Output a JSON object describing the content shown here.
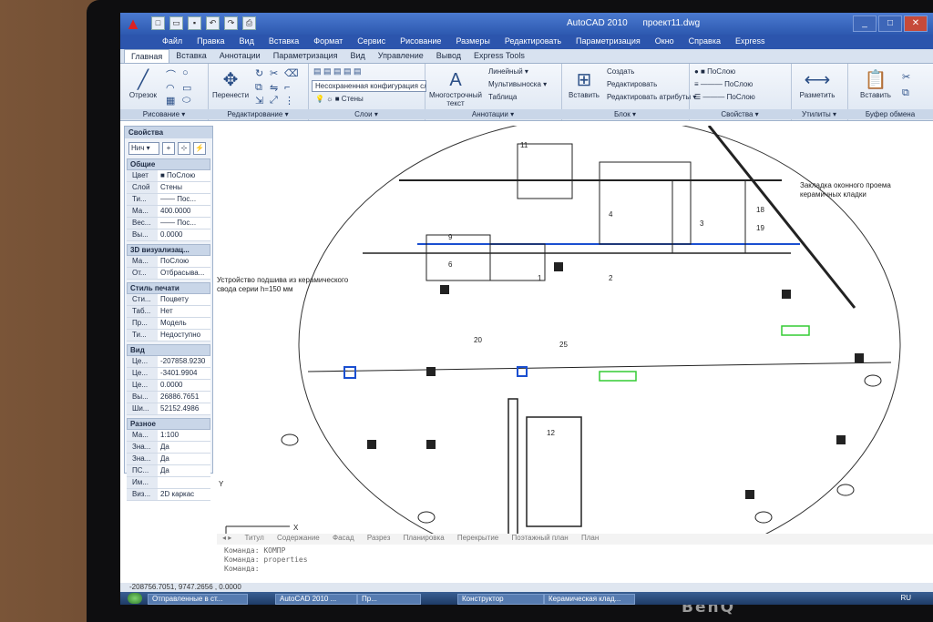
{
  "window": {
    "app_title": "AutoCAD 2010",
    "file_title": "проект11.dwg"
  },
  "menu": [
    "Файл",
    "Правка",
    "Вид",
    "Вставка",
    "Формат",
    "Сервис",
    "Рисование",
    "Размеры",
    "Редактировать",
    "Параметризация",
    "Окно",
    "Справка",
    "Express"
  ],
  "tabs": [
    "Главная",
    "Вставка",
    "Аннотации",
    "Параметризация",
    "Вид",
    "Управление",
    "Вывод",
    "Express Tools"
  ],
  "ribbon": {
    "draw": {
      "line_label": "Отрезок",
      "panel": "Рисование ▾"
    },
    "modify": {
      "move_label": "Перенести",
      "panel": "Редактирование ▾"
    },
    "layers": {
      "layer_state": "Несохраненная конфигурация сл ▾",
      "current_layer": "Стены",
      "panel": "Слои ▾"
    },
    "annotation": {
      "mtext_label": "Многострочный текст",
      "linear": "Линейный ▾",
      "mleader": "Мультивыноска ▾",
      "table": "Таблица",
      "panel": "Аннотации ▾"
    },
    "block": {
      "insert_label": "Вставить",
      "create": "Создать",
      "edit": "Редактировать",
      "edit_attr": "Редактировать атрибуты ▾",
      "panel": "Блок ▾"
    },
    "properties": {
      "color": "ПоСлою",
      "linetype": "ПоСлою",
      "lineweight": "ПоСлою",
      "panel": "Свойства ▾"
    },
    "utilities": {
      "measure_label": "Разметить",
      "panel": "Утилиты ▾"
    },
    "clipboard": {
      "paste_label": "Вставить",
      "panel": "Буфер обмена"
    }
  },
  "properties_panel": {
    "title": "Свойства",
    "selector": "Нич ▾",
    "sections": [
      {
        "title": "Общие",
        "rows": [
          [
            "Цвет",
            "■ ПоСлою"
          ],
          [
            "Слой",
            "Стены"
          ],
          [
            "Ти...",
            "—— Пос..."
          ],
          [
            "Ма...",
            "400.0000"
          ],
          [
            "Вес...",
            "—— Пос..."
          ],
          [
            "Вы...",
            "0.0000"
          ]
        ]
      },
      {
        "title": "3D визуализац...",
        "rows": [
          [
            "Ма...",
            "ПоСлою"
          ],
          [
            "От...",
            "Отбрасыва..."
          ]
        ]
      },
      {
        "title": "Стиль печати",
        "rows": [
          [
            "Сти...",
            "Поцвету"
          ],
          [
            "Таб...",
            "Нет"
          ],
          [
            "Пр...",
            "Модель"
          ],
          [
            "Ти...",
            "Недоступно"
          ]
        ]
      },
      {
        "title": "Вид",
        "rows": [
          [
            "Це...",
            "-207858.9230"
          ],
          [
            "Це...",
            "-3401.9904"
          ],
          [
            "Це...",
            "0.0000"
          ],
          [
            "Вы...",
            "26886.7651"
          ],
          [
            "Ши...",
            "52152.4986"
          ]
        ]
      },
      {
        "title": "Разное",
        "rows": [
          [
            "Ма...",
            "1:100"
          ],
          [
            "Зна...",
            "Да"
          ],
          [
            "Зна...",
            "Да"
          ],
          [
            "ПС...",
            "Да"
          ],
          [
            "Им...",
            ""
          ],
          [
            "Виз...",
            "2D каркас"
          ]
        ]
      }
    ]
  },
  "drawing": {
    "annot1": "Закладка оконного проема",
    "annot2": "керамичных кладки",
    "annot3": "Устройство подшива из керамического",
    "annot4": "свода серии h=150 мм",
    "room_labels": [
      "1",
      "2",
      "3",
      "4",
      "6",
      "9",
      "12",
      "18",
      "19",
      "20",
      "25",
      "11"
    ],
    "ucs_x": "X",
    "ucs_y": "Y"
  },
  "layout_tabs": [
    "Титул",
    "Содержание",
    "Фасад",
    "Разрез",
    "Планировка",
    "Перекрытие",
    "Поэтажный план",
    "План"
  ],
  "command": {
    "line1": "Команда: КОМПР",
    "line2": "Команда: properties",
    "line3": "Команда:"
  },
  "status": {
    "coords": "-208756.7051, 9747.2656 , 0.0000"
  },
  "taskbar": {
    "items": [
      "Отправленные в ст...",
      "AutoCAD 2010 ...",
      "Пр...",
      "Конструктор",
      "Керамическая клад..."
    ],
    "lang": "RU"
  }
}
